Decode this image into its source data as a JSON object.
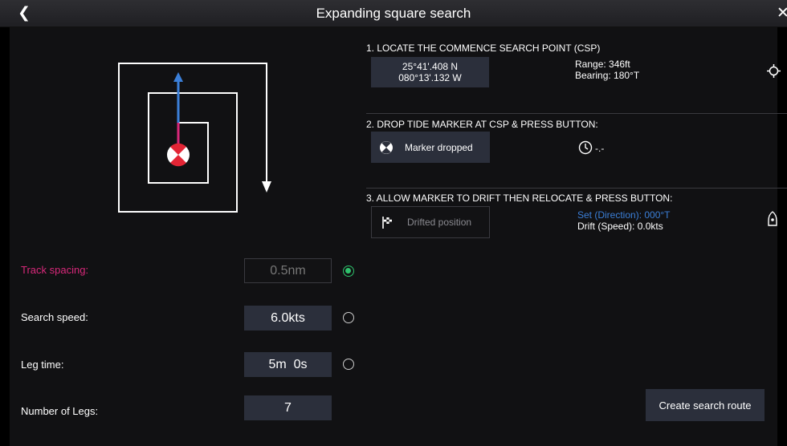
{
  "header": {
    "title": "Expanding square search",
    "back_icon": "chevron-left-icon",
    "close_icon": "close-icon"
  },
  "params": {
    "track_spacing": {
      "label": "Track spacing:",
      "value": "0.5nm",
      "selected": true
    },
    "search_speed": {
      "label": "Search speed:",
      "value": "6.0kts",
      "selected": false
    },
    "leg_time": {
      "label": "Leg time:",
      "value": "5m  0s",
      "selected": false
    },
    "number_of_legs": {
      "label": "Number of Legs:",
      "value": "7"
    }
  },
  "step1": {
    "title": "1. LOCATE THE COMMENCE SEARCH POINT (CSP)",
    "lat": "25°41'.408 N",
    "lon": "080°13'.132 W",
    "range": "Range: 346ft",
    "bearing": "Bearing: 180°T",
    "icon": "crosshair-icon"
  },
  "step2": {
    "title": "2. DROP TIDE MARKER AT CSP & PRESS BUTTON:",
    "button_label": "Marker dropped",
    "button_icon": "tide-marker-icon",
    "time_value": "-.-",
    "time_icon": "clock-icon"
  },
  "step3": {
    "title": "3. ALLOW MARKER TO DRIFT THEN RELOCATE & PRESS BUTTON:",
    "button_label": "Drifted position",
    "button_icon": "checkered-flag-icon",
    "set": "Set (Direction): 000°T",
    "drift": "Drift (Speed): 0.0kts",
    "icon": "vessel-icon"
  },
  "actions": {
    "create_route": "Create search route"
  },
  "colors": {
    "accent_pink": "#d8287a",
    "accent_blue": "#3b7fd8",
    "selected_green": "#2fc26c",
    "field_bg": "#2b2f3b"
  }
}
